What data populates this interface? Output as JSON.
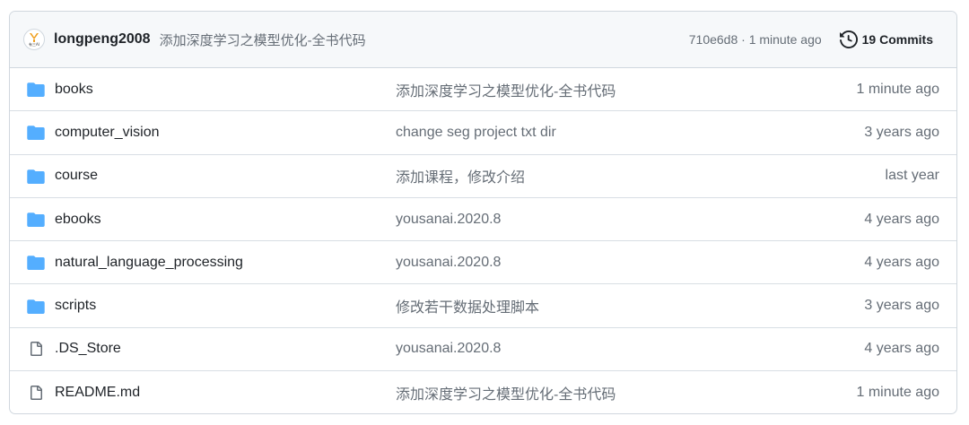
{
  "header": {
    "avatar_icon": "yousanai-logo-icon",
    "avatar_text": "有三AI",
    "username": "longpeng2008",
    "commit_message": "添加深度学习之模型优化-全书代码",
    "commit_meta": "710e6d8 · 1 minute ago",
    "history_icon": "history-clock-icon",
    "commits_label": "19 Commits"
  },
  "files": [
    {
      "type": "folder",
      "icon": "folder-icon",
      "name": "books",
      "message": "添加深度学习之模型优化-全书代码",
      "age": "1 minute ago"
    },
    {
      "type": "folder",
      "icon": "folder-icon",
      "name": "computer_vision",
      "message": "change seg project txt dir",
      "age": "3 years ago"
    },
    {
      "type": "folder",
      "icon": "folder-icon",
      "name": "course",
      "message": "添加课程，修改介绍",
      "age": "last year"
    },
    {
      "type": "folder",
      "icon": "folder-icon",
      "name": "ebooks",
      "message": "yousanai.2020.8",
      "age": "4 years ago"
    },
    {
      "type": "folder",
      "icon": "folder-icon",
      "name": "natural_language_processing",
      "message": "yousanai.2020.8",
      "age": "4 years ago"
    },
    {
      "type": "folder",
      "icon": "folder-icon",
      "name": "scripts",
      "message": "修改若干数据处理脚本",
      "age": "3 years ago"
    },
    {
      "type": "file",
      "icon": "file-icon",
      "name": ".DS_Store",
      "message": "yousanai.2020.8",
      "age": "4 years ago"
    },
    {
      "type": "file",
      "icon": "file-icon",
      "name": "README.md",
      "message": "添加深度学习之模型优化-全书代码",
      "age": "1 minute ago"
    }
  ],
  "colors": {
    "folder": "#54aeff",
    "file": "#656d76",
    "border": "#d0d7de",
    "header_bg": "#f6f8fa"
  }
}
